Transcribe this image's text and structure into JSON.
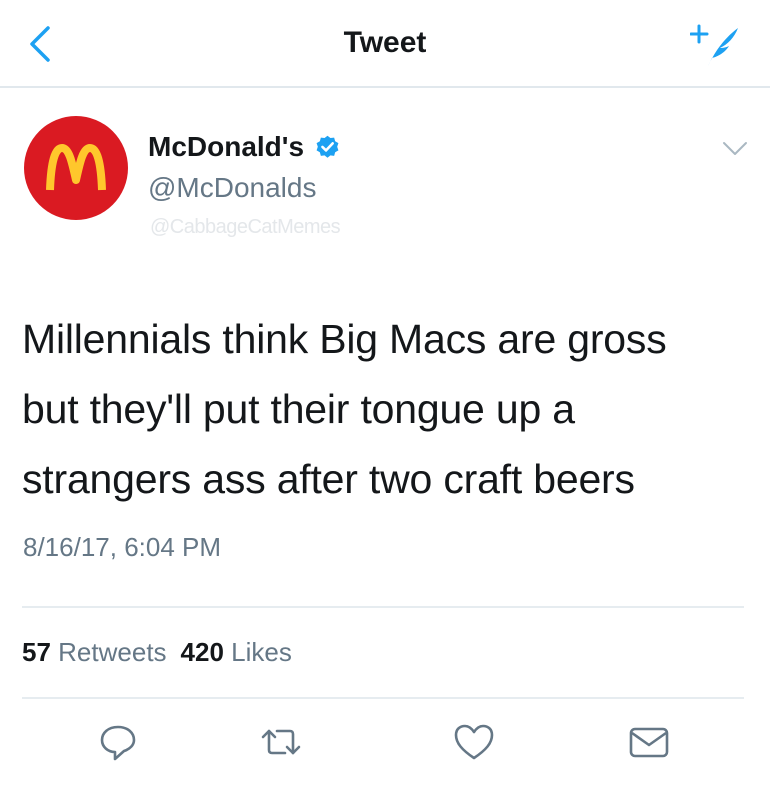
{
  "header": {
    "title": "Tweet",
    "back_icon": "chevron-left-icon",
    "compose_icon": "compose-tweet-icon",
    "accent": "#1da1f2"
  },
  "author": {
    "display_name": "McDonald's",
    "handle": "@McDonalds",
    "verified": true,
    "avatar_bg": "#da1a22",
    "avatar_logo_color": "#ffc72c"
  },
  "watermark": "@CabbageCatMemes",
  "tweet": {
    "lines": [
      "Millennials think Big Macs are gross",
      "but they'll put their tongue up a",
      "strangers ass after two craft beers"
    ],
    "timestamp": "8/16/17, 6:04 PM"
  },
  "stats": {
    "retweets_count": "57",
    "retweets_label": "Retweets",
    "likes_count": "420",
    "likes_label": "Likes"
  },
  "actions": [
    "reply-icon",
    "retweet-icon",
    "like-icon",
    "direct-message-icon"
  ]
}
